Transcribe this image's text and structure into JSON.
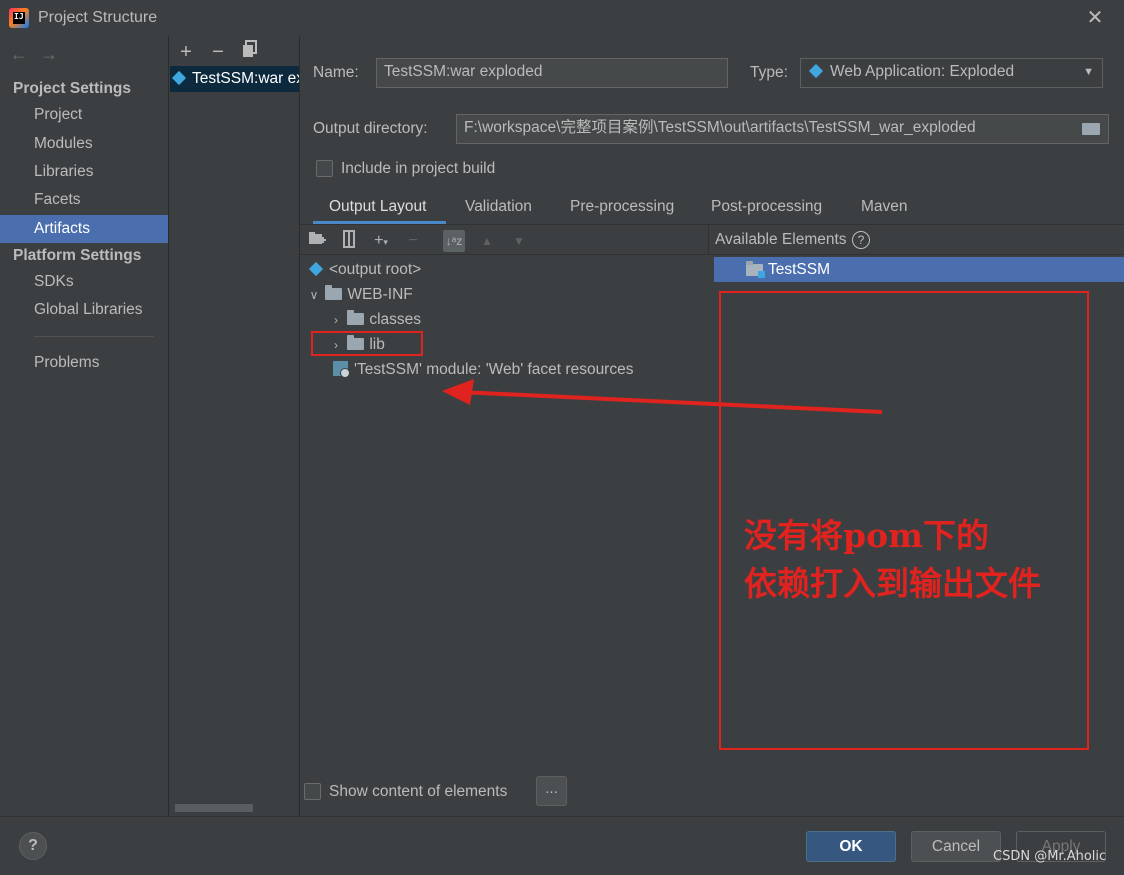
{
  "window": {
    "title": "Project Structure"
  },
  "nav": {
    "back_icon": "arrow-left-icon",
    "forward_icon": "arrow-right-icon",
    "project_settings_header": "Project Settings",
    "project_items": [
      "Project",
      "Modules",
      "Libraries",
      "Facets",
      "Artifacts"
    ],
    "selected_item": "Artifacts",
    "platform_settings_header": "Platform Settings",
    "platform_items": [
      "SDKs",
      "Global Libraries"
    ],
    "problems": "Problems"
  },
  "artifacts": {
    "add_label": "+",
    "remove_label": "−",
    "copy_icon": "copy-icon",
    "items": [
      {
        "label": "TestSSM:war exploded"
      }
    ]
  },
  "form": {
    "name_label": "Name:",
    "name_value": "TestSSM:war exploded",
    "type_label": "Type:",
    "type_value": "Web Application: Exploded",
    "output_dir_label": "Output directory:",
    "output_dir_value": "F:\\workspace\\完整项目案例\\TestSSM\\out\\artifacts\\TestSSM_war_exploded",
    "include_in_build_label": "Include in project build",
    "include_in_build_checked": false
  },
  "tabs": [
    {
      "label": "Output Layout",
      "active": true
    },
    {
      "label": "Validation",
      "active": false
    },
    {
      "label": "Pre-processing",
      "active": false
    },
    {
      "label": "Post-processing",
      "active": false
    },
    {
      "label": "Maven",
      "active": false
    }
  ],
  "layout_tree": [
    {
      "label": "<output root>",
      "icon": "output-root-icon",
      "depth": 0
    },
    {
      "label": "WEB-INF",
      "icon": "folder-icon",
      "depth": 0,
      "expanded": true
    },
    {
      "label": "classes",
      "icon": "folder-icon",
      "depth": 1,
      "expanded": false
    },
    {
      "label": "lib",
      "icon": "folder-icon",
      "depth": 1,
      "expanded": false
    },
    {
      "label": "'TestSSM' module: 'Web' facet resources",
      "icon": "web-facet-icon",
      "depth": 0
    }
  ],
  "available": {
    "header": "Available Elements",
    "items": [
      {
        "label": "TestSSM",
        "selected": true
      }
    ]
  },
  "annotation": {
    "line1": "没有将pom下的",
    "line2": "依赖打入到输出文件",
    "color": "#e0231e"
  },
  "bottom": {
    "show_content_label": "Show content of elements",
    "show_content_checked": false,
    "ellipsis_label": "...",
    "help_label": "?",
    "ok_label": "OK",
    "cancel_label": "Cancel",
    "apply_label": "Apply",
    "watermark": "CSDN @Mr.Aholic"
  }
}
